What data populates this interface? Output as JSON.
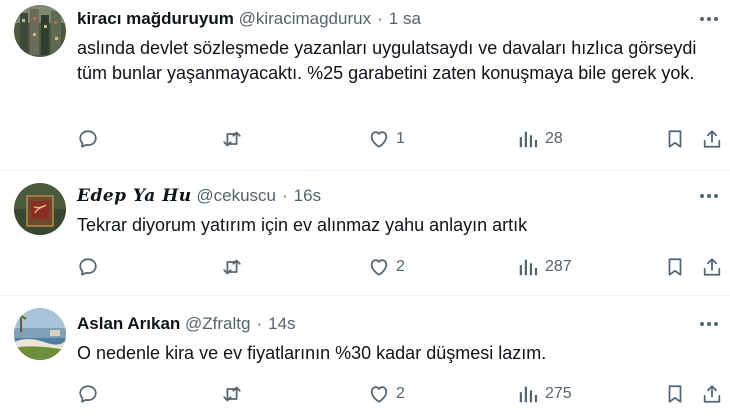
{
  "tweets": [
    {
      "name": "kiracı mağduruyum",
      "handle": "@kiracimagdurux",
      "separator": "·",
      "time": "1 sa",
      "text": "aslında devlet sözleşmede yazanları uygulatsaydı ve davaları hızlıca görseydi tüm bunlar yaşanmayacaktı. %25 garabetini zaten konuşmaya bile gerek yok.",
      "replies": "",
      "reposts": "",
      "likes": "1",
      "views": "28"
    },
    {
      "name": "Edep Ya Hu",
      "handle": "@cekuscu",
      "separator": "·",
      "time": "16s",
      "text": "Tekrar diyorum yatırım için ev alınmaz yahu anlayın artık",
      "replies": "",
      "reposts": "",
      "likes": "2",
      "views": "287"
    },
    {
      "name": "Aslan Arıkan",
      "handle": "@Zfraltg",
      "separator": "·",
      "time": "14s",
      "text": "O nedenle kira ve ev fiyatlarının %30 kadar düşmesi lazım.",
      "replies": "",
      "reposts": "",
      "likes": "2",
      "views": "275"
    }
  ],
  "icons": {
    "more": "more-horizontal-icon",
    "reply": "reply-bubble-icon",
    "repost": "repost-arrows-icon",
    "like": "heart-icon",
    "views": "views-bars-icon",
    "bookmark": "bookmark-icon",
    "share": "share-upload-icon"
  },
  "colors": {
    "text": "#0f1419",
    "secondary": "#536471",
    "divider": "#eff3f4"
  }
}
